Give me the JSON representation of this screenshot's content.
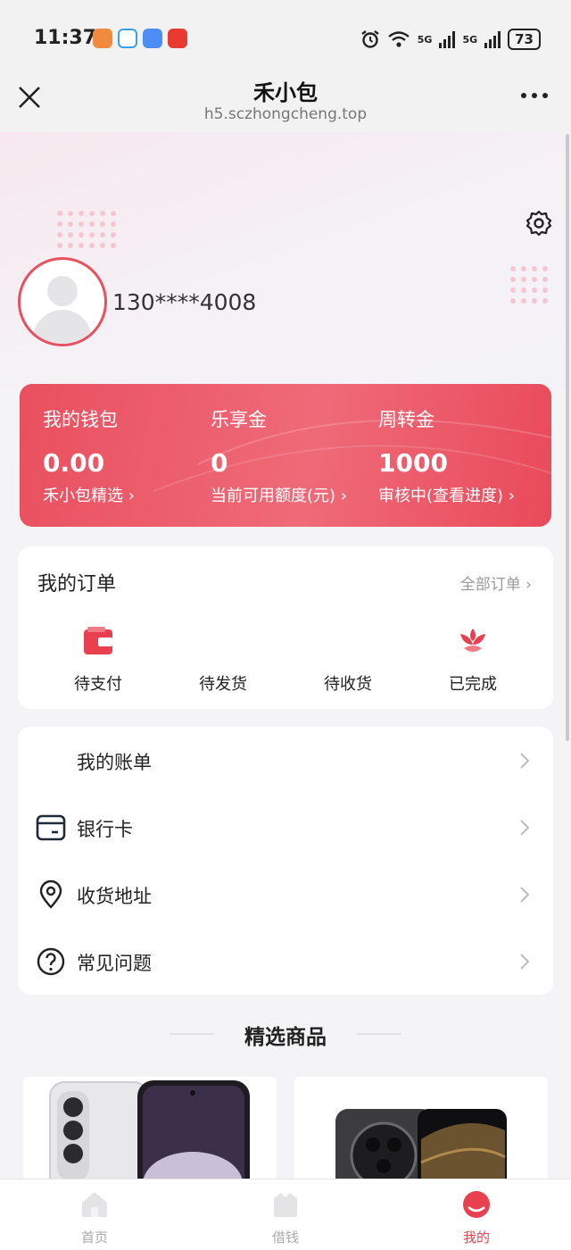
{
  "status_bar": {
    "time": "11:37",
    "network_1": "5G",
    "network_2": "5G",
    "battery": "73",
    "app_icon_colors": [
      "#f08a3c",
      "#3aa0e8",
      "#4c8df6",
      "#e83a30"
    ],
    "icons": [
      "alarm-icon",
      "wifi-icon",
      "signal-icon",
      "battery-icon"
    ]
  },
  "titlebar": {
    "title": "禾小包",
    "url": "h5.sczhongcheng.top",
    "icons": [
      "close-icon",
      "more-icon"
    ]
  },
  "profile": {
    "phone": "130****4008",
    "icons": [
      "settings-gear-icon",
      "avatar-icon"
    ]
  },
  "wallet": {
    "columns": [
      {
        "title": "我的钱包",
        "value": "0.00",
        "sub": "禾小包精选"
      },
      {
        "title": "乐享金",
        "value": "0",
        "sub": "当前可用额度(元)"
      },
      {
        "title": "周转金",
        "value": "1000",
        "sub": "审核中(查看进度)"
      }
    ]
  },
  "orders": {
    "title": "我的订单",
    "all_label": "全部订单",
    "items": [
      {
        "label": "待支付",
        "icon": "wallet-icon"
      },
      {
        "label": "待发货",
        "icon": ""
      },
      {
        "label": "待收货",
        "icon": ""
      },
      {
        "label": "已完成",
        "icon": "flower-icon"
      }
    ]
  },
  "menu": {
    "items": [
      {
        "label": "我的账单",
        "icon": ""
      },
      {
        "label": "银行卡",
        "icon": "bank-card-icon"
      },
      {
        "label": "收货地址",
        "icon": "location-pin-icon"
      },
      {
        "label": "常见问题",
        "icon": "question-icon"
      }
    ]
  },
  "featured": {
    "title": "精选商品",
    "products": [
      {
        "image": "white-smartphone-image"
      },
      {
        "image": "dark-smartphone-image"
      }
    ]
  },
  "tabbar": {
    "items": [
      {
        "label": "首页",
        "icon": "home-icon",
        "active": false
      },
      {
        "label": "借钱",
        "icon": "bag-icon",
        "active": false
      },
      {
        "label": "我的",
        "icon": "profile-icon",
        "active": true
      }
    ]
  },
  "colors": {
    "accent": "#e8404f",
    "wallet_gradient_start": "#e9505f",
    "wallet_gradient_end": "#ef6a78",
    "page_background": "#f4f4f6"
  }
}
